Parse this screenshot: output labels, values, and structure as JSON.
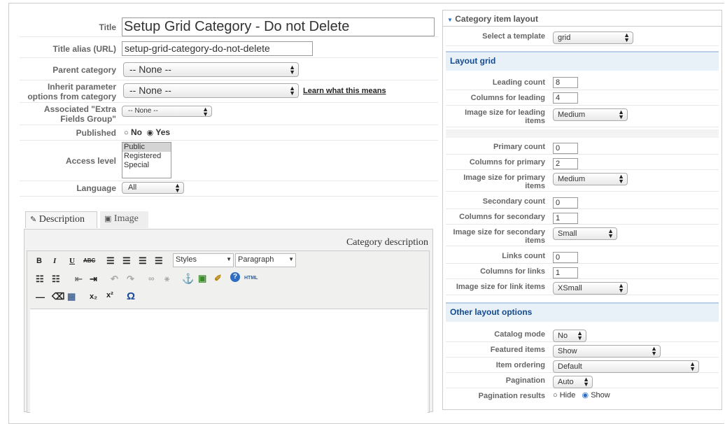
{
  "left": {
    "title_label": "Title",
    "title_value": "Setup Grid Category - Do not Delete",
    "alias_label": "Title alias (URL)",
    "alias_value": "setup-grid-category-do-not-delete",
    "parent_label": "Parent category",
    "parent_value": "-- None --",
    "inherit_label_1": "Inherit parameter",
    "inherit_label_2": "options from category",
    "inherit_value": "-- None --",
    "inherit_link": "Learn what this means",
    "extra_label_1": "Associated \"Extra",
    "extra_label_2": "Fields Group\"",
    "extra_value": "-- None --",
    "published_label": "Published",
    "published_no": "No",
    "published_yes": "Yes",
    "access_label": "Access level",
    "access_options": [
      "Public",
      "Registered",
      "Special"
    ],
    "language_label": "Language",
    "language_value": "All",
    "tab_description": "Description",
    "tab_image": "Image",
    "editor_title": "Category description",
    "styles_value": "Styles",
    "format_value": "Paragraph"
  },
  "right": {
    "header": "Category item layout",
    "template_label": "Select a template",
    "template_value": "grid",
    "layout_grid": "Layout grid",
    "leading_count_label": "Leading count",
    "leading_count": "8",
    "columns_leading_label": "Columns for leading",
    "columns_leading": "4",
    "image_leading_label_1": "Image size for leading",
    "image_leading_label_2": "items",
    "image_leading": "Medium",
    "primary_count_label": "Primary count",
    "primary_count": "0",
    "columns_primary_label": "Columns for primary",
    "columns_primary": "2",
    "image_primary_label_1": "Image size for primary",
    "image_primary_label_2": "items",
    "image_primary": "Medium",
    "secondary_count_label": "Secondary count",
    "secondary_count": "0",
    "columns_secondary_label": "Columns for secondary",
    "columns_secondary": "1",
    "image_secondary_label_1": "Image size for secondary",
    "image_secondary_label_2": "items",
    "image_secondary": "Small",
    "links_count_label": "Links count",
    "links_count": "0",
    "columns_links_label": "Columns for links",
    "columns_links": "1",
    "image_links_label": "Image size for link items",
    "image_links": "XSmall",
    "other_options": "Other layout options",
    "catalog_mode_label": "Catalog mode",
    "catalog_mode": "No",
    "featured_label": "Featured items",
    "featured": "Show",
    "ordering_label": "Item ordering",
    "ordering": "Default",
    "pagination_label": "Pagination",
    "pagination": "Auto",
    "pagination_results_label": "Pagination results",
    "pagination_hide": "Hide",
    "pagination_show": "Show"
  }
}
